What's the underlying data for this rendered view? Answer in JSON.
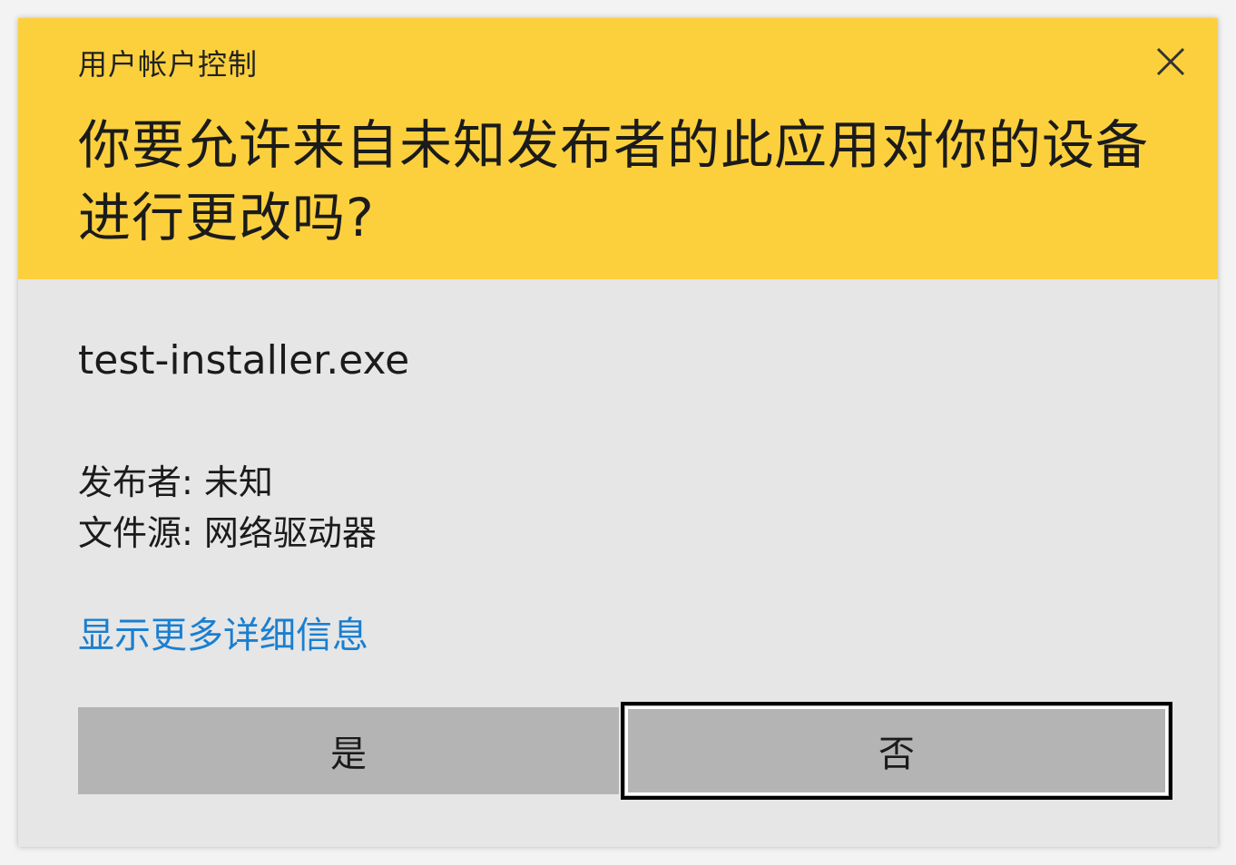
{
  "dialog": {
    "title": "用户帐户控制",
    "question": "你要允许来自未知发布者的此应用对你的设备进行更改吗?",
    "app_name": "test-installer.exe",
    "publisher_line": "发布者: 未知",
    "source_line": "文件源: 网络驱动器",
    "more_details_link": "显示更多详细信息",
    "yes_label": "是",
    "no_label": "否",
    "close_icon": "close-icon"
  },
  "colors": {
    "header_bg": "#fcd03d",
    "body_bg": "#e6e6e6",
    "button_bg": "#b4b4b4",
    "link": "#1a7fd0"
  }
}
